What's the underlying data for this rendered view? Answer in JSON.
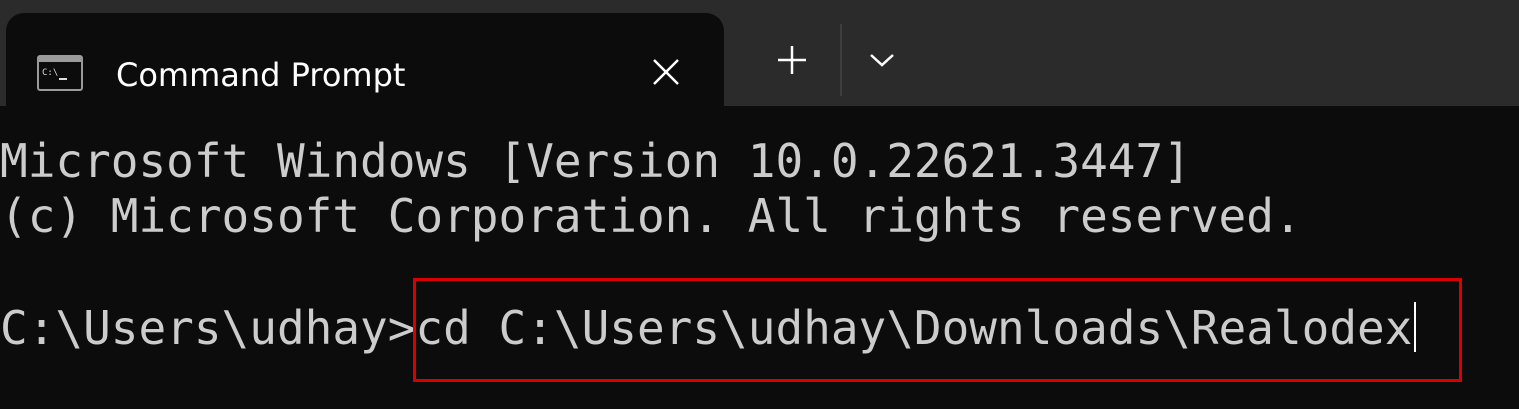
{
  "tab": {
    "title": "Command Prompt",
    "icon": "cmd-icon",
    "icon_text": "C:\\"
  },
  "tabbar": {
    "close_icon": "close-icon",
    "new_tab_icon": "plus-icon",
    "dropdown_icon": "chevron-down-icon"
  },
  "terminal": {
    "header_line1": "Microsoft Windows [Version 10.0.22621.3447]",
    "header_line2": "(c) Microsoft Corporation. All rights reserved.",
    "prompt": "C:\\Users\\udhay>",
    "command": "cd C:\\Users\\udhay\\Downloads\\Realodex"
  },
  "colors": {
    "titlebar_bg": "#2b2b2b",
    "terminal_bg": "#0c0c0c",
    "text": "#cccccc",
    "highlight_border": "#d90000"
  }
}
